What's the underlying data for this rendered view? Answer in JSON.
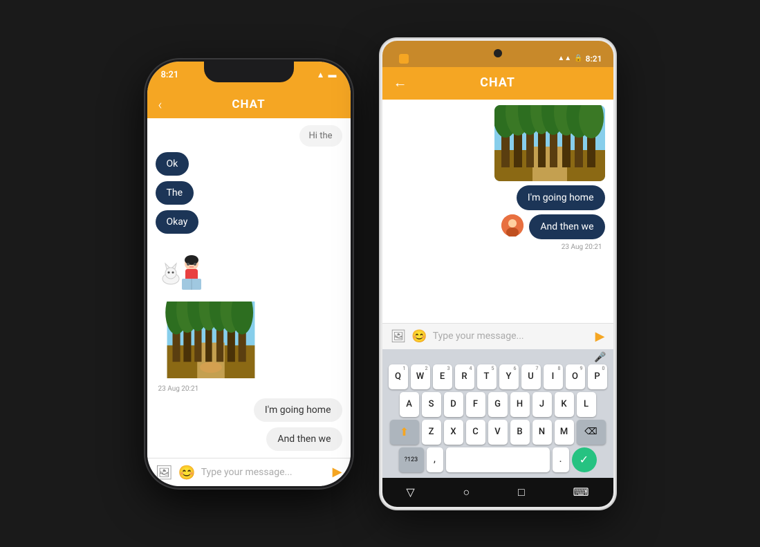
{
  "ios": {
    "status_time": "8:21",
    "header_title": "CHAT",
    "back_label": "‹",
    "messages_received": [
      {
        "text": "Ok",
        "type": "dark"
      },
      {
        "text": "The",
        "type": "dark"
      },
      {
        "text": "Okay",
        "type": "dark"
      }
    ],
    "timestamp": "23 Aug 20:21",
    "sent_messages": [
      {
        "text": "I'm going home"
      },
      {
        "text": "And then we"
      }
    ],
    "input_placeholder": "Type your message...",
    "send_icon": "▶"
  },
  "android": {
    "status_time": "8:21",
    "header_title": "CHAT",
    "back_label": "←",
    "sent_messages": [
      {
        "text": "I'm going home"
      },
      {
        "text": "And then we"
      }
    ],
    "timestamp": "23 Aug 20:21",
    "input_placeholder": "Type your message...",
    "send_icon": "▶",
    "keyboard": {
      "rows": [
        [
          "Q",
          "W",
          "E",
          "R",
          "T",
          "Y",
          "U",
          "I",
          "O",
          "P"
        ],
        [
          "A",
          "S",
          "D",
          "F",
          "G",
          "H",
          "J",
          "K",
          "L"
        ],
        [
          "Z",
          "X",
          "C",
          "V",
          "B",
          "N",
          "M"
        ]
      ],
      "nums": [
        "1",
        "2",
        "3",
        "4",
        "5",
        "6",
        "7",
        "8",
        "9",
        "0"
      ]
    }
  },
  "colors": {
    "orange": "#f5a623",
    "dark_blue": "#1c3557",
    "background": "#1a1a1a"
  }
}
